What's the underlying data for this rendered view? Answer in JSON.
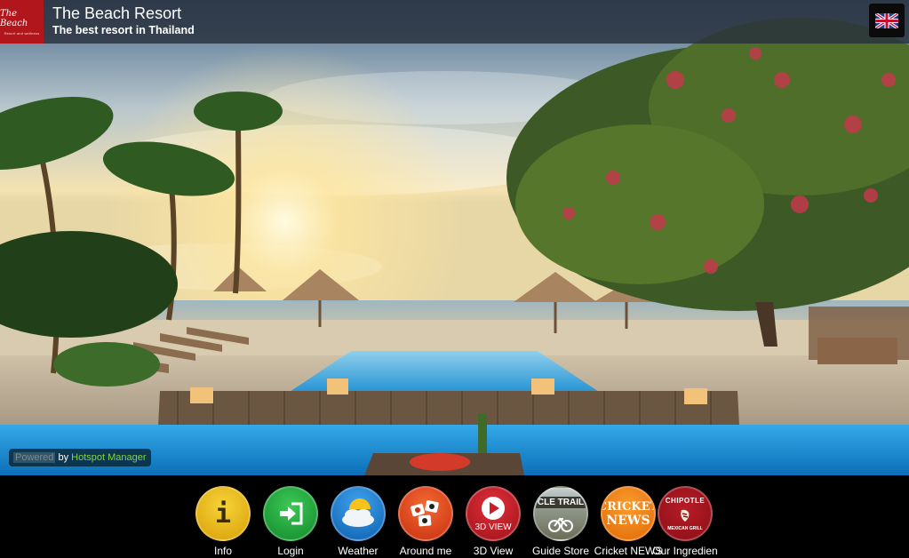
{
  "header": {
    "logo_text": "The Beach",
    "logo_tagline": "Resort and wellness",
    "title": "The Beach Resort",
    "subtitle": "The best resort in Thailand",
    "language_flag": "uk-flag-icon"
  },
  "powered": {
    "prefix": "Powered",
    "by": " by ",
    "brand": "Hotspot Manager"
  },
  "dock": {
    "items": [
      {
        "label": "Info",
        "icon": "info-icon",
        "color": "#e4b510"
      },
      {
        "label": "Login",
        "icon": "login-icon",
        "color": "#1fa23a"
      },
      {
        "label": "Weather",
        "icon": "weather-icon",
        "color": "#1b79cf"
      },
      {
        "label": "Around me",
        "icon": "around-me-icon",
        "color": "#e8441b"
      },
      {
        "label": "3D View",
        "icon": "play-icon",
        "text": "3D VIEW",
        "color": "#c81e25"
      },
      {
        "label": "Guide Store",
        "icon": "cycle-trails-icon",
        "text": "CLE TRAIL",
        "color": "#8c8c7c"
      },
      {
        "label": "Cricket NEWS",
        "icon": "cricket-news-icon",
        "text_top": "CRICKET",
        "text_bottom": "NEWS",
        "color": "#f07d13"
      },
      {
        "label": "Our Ingredien",
        "icon": "chipotle-icon",
        "text_top": "CHIPOTLE",
        "text_bottom": "MEXICAN GRILL",
        "color": "#a3161f"
      }
    ]
  },
  "colors": {
    "header_bg": "#28303c",
    "logo_bg": "#b0161b",
    "powered_brand": "#7cd838",
    "dock_bg": "#000000"
  }
}
